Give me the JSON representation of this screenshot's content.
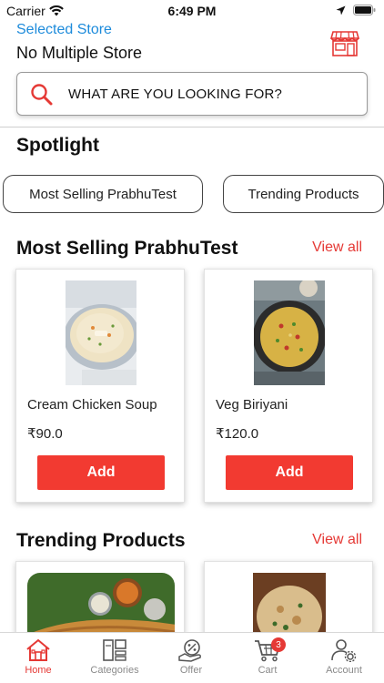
{
  "status_bar": {
    "carrier": "Carrier",
    "time": "6:49 PM"
  },
  "header": {
    "selected_store_label": "Selected Store",
    "store_name": "No Multiple Store",
    "search_placeholder": "WHAT ARE YOU LOOKING FOR?"
  },
  "spotlight": {
    "title": "Spotlight",
    "chips": [
      "Most Selling PrabhuTest",
      "Trending Products"
    ]
  },
  "sections": [
    {
      "title": "Most Selling PrabhuTest",
      "view_all": "View all",
      "products": [
        {
          "name": "Cream Chicken Soup",
          "price": "₹90.0",
          "button": "Add",
          "image": "soup-image"
        },
        {
          "name": "Veg Biriyani",
          "price": "₹120.0",
          "button": "Add",
          "image": "biriyani-image"
        }
      ]
    },
    {
      "title": "Trending Products",
      "view_all": "View all",
      "products": [
        {
          "image": "dosa-image"
        },
        {
          "image": "naan-image"
        }
      ]
    }
  ],
  "tab_bar": {
    "items": [
      {
        "label": "Home",
        "icon": "home-icon",
        "active": true
      },
      {
        "label": "Categories",
        "icon": "categories-icon",
        "active": false
      },
      {
        "label": "Offer",
        "icon": "offer-icon",
        "active": false
      },
      {
        "label": "Cart",
        "icon": "cart-icon",
        "active": false,
        "badge": "3"
      },
      {
        "label": "Account",
        "icon": "account-icon",
        "active": false
      }
    ]
  },
  "colors": {
    "accent": "#e53935",
    "link_blue": "#1d8bdb",
    "button_red": "#f23a31"
  }
}
